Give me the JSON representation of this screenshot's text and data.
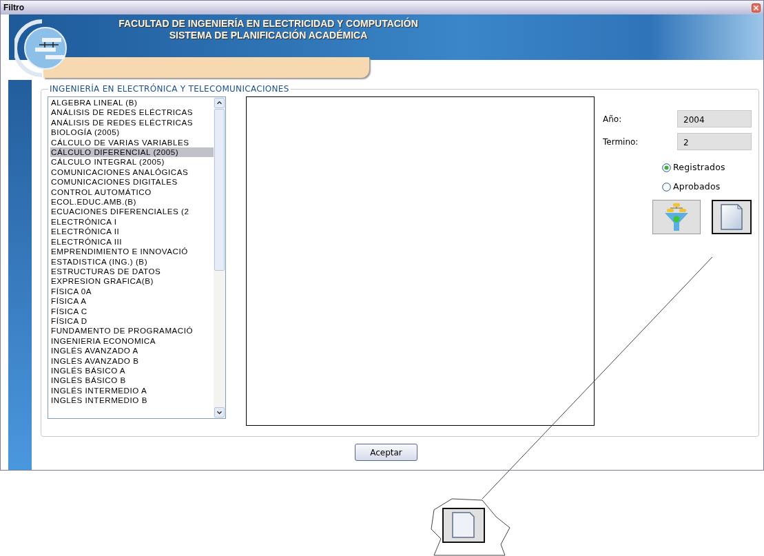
{
  "window": {
    "title": "Filtro"
  },
  "header": {
    "line_1": "FACULTAD DE INGENIERÍA EN ELECTRICIDAD Y COMPUTACIÓN",
    "line_2": "SISTEMA DE PLANIFICACIÓN ACADÉMICA"
  },
  "panel": {
    "legend": "INGENIERÍA EN ELECTRÓNICA Y TELECOMUNICACIONES"
  },
  "subjects": [
    {
      "label": "ALGEBRA LINEAL (B)",
      "selected": false
    },
    {
      "label": "ANÁLISIS DE REDES ELÉCTRICAS",
      "selected": false
    },
    {
      "label": "ANÁLISIS DE REDES ELÉCTRICAS",
      "selected": false
    },
    {
      "label": "BIOLOGÍA (2005)",
      "selected": false
    },
    {
      "label": "CÁLCULO DE VARIAS VARIABLES",
      "selected": false
    },
    {
      "label": "CÁLCULO DIFERENCIAL (2005)",
      "selected": true
    },
    {
      "label": "CÁLCULO INTEGRAL (2005)",
      "selected": false
    },
    {
      "label": "COMUNICACIONES ANALÓGICAS",
      "selected": false
    },
    {
      "label": "COMUNICACIONES DIGITALES",
      "selected": false
    },
    {
      "label": "CONTROL AUTOMÁTICO",
      "selected": false
    },
    {
      "label": "ECOL.EDUC.AMB.(B)",
      "selected": false
    },
    {
      "label": "ECUACIONES DIFERENCIALES (2",
      "selected": false
    },
    {
      "label": "ELECTRÓNICA I",
      "selected": false
    },
    {
      "label": "ELECTRÓNICA II",
      "selected": false
    },
    {
      "label": "ELECTRÓNICA III",
      "selected": false
    },
    {
      "label": "EMPRENDIMIENTO E INNOVACIÓ",
      "selected": false
    },
    {
      "label": "ESTADISTICA (ING.) (B)",
      "selected": false
    },
    {
      "label": "ESTRUCTURAS DE DATOS",
      "selected": false
    },
    {
      "label": "EXPRESION GRAFICA(B)",
      "selected": false
    },
    {
      "label": "FÍSICA 0A",
      "selected": false
    },
    {
      "label": "FÍSICA A",
      "selected": false
    },
    {
      "label": "FÍSICA C",
      "selected": false
    },
    {
      "label": "FÍSICA D",
      "selected": false
    },
    {
      "label": "FUNDAMENTO DE PROGRAMACIÓ",
      "selected": false
    },
    {
      "label": "INGENIERIA ECONOMICA",
      "selected": false
    },
    {
      "label": "INGLÉS AVANZADO A",
      "selected": false
    },
    {
      "label": "INGLÉS AVANZADO B",
      "selected": false
    },
    {
      "label": "INGLÉS BÁSICO A",
      "selected": false
    },
    {
      "label": "INGLÉS BÁSICO B",
      "selected": false
    },
    {
      "label": "INGLÉS INTERMEDIO A",
      "selected": false
    },
    {
      "label": "INGLÉS INTERMEDIO B",
      "selected": false
    }
  ],
  "fields": [
    {
      "label": "Año:",
      "value": "2004"
    },
    {
      "label": "Termino:",
      "value": "2"
    }
  ],
  "options": [
    {
      "label": "Registrados",
      "selected": true
    },
    {
      "label": "Aprobados",
      "selected": false
    }
  ],
  "accept_button": "Aceptar"
}
